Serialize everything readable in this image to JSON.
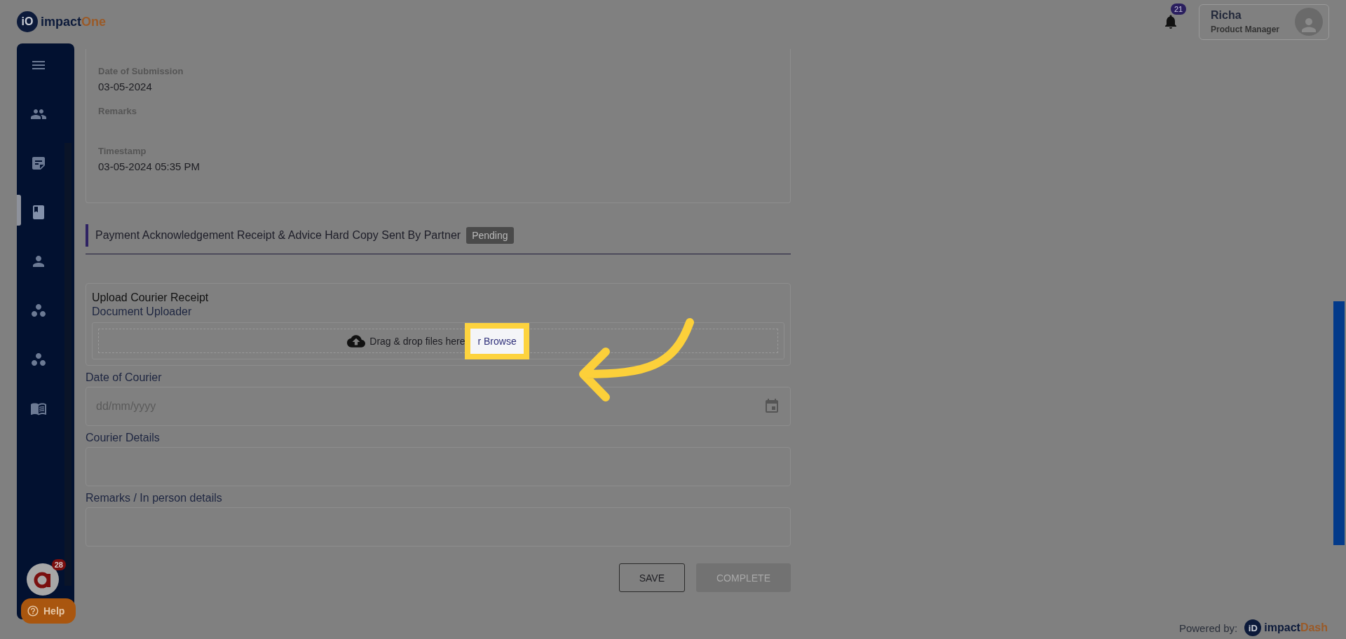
{
  "logo": {
    "mark": "iO",
    "name": "impact",
    "accent": "One"
  },
  "header": {
    "notifications": "21",
    "user": {
      "name": "Richa",
      "role": "Product Manager"
    }
  },
  "sidebar": {
    "items": [
      {
        "kind": "menu",
        "selected": false
      },
      {
        "kind": "people",
        "selected": false
      },
      {
        "kind": "note",
        "selected": false
      },
      {
        "kind": "book",
        "selected": true
      },
      {
        "kind": "person",
        "selected": false
      },
      {
        "kind": "dots",
        "selected": false
      },
      {
        "kind": "dots",
        "selected": false
      },
      {
        "kind": "manual",
        "selected": false
      }
    ],
    "chat_badge": "28",
    "help": "Help"
  },
  "details": [
    {
      "label": "Date of Submission",
      "value": "03-05-2024"
    },
    {
      "label": "Remarks"
    },
    {
      "label": "Timestamp",
      "value": "03-05-2024 05:35 PM"
    }
  ],
  "section": {
    "title": "Payment Acknowledgement Receipt & Advice Hard Copy Sent By Partner",
    "status": "Pending"
  },
  "upload": {
    "title": "Upload Courier Receipt",
    "subtitle": "Document Uploader",
    "drop_text": "Drag & drop files here",
    "browse": "r Browse"
  },
  "fields": [
    {
      "kind": "date",
      "label": "Date of Courier",
      "placeholder": "dd/mm/yyyy"
    },
    {
      "kind": "text",
      "label": "Courier Details"
    },
    {
      "kind": "text",
      "label": "Remarks / In person details"
    }
  ],
  "buttons": [
    {
      "label": "SAVE",
      "disabled": false
    },
    {
      "label": "COMPLETE",
      "disabled": true
    }
  ],
  "footer": {
    "powered": "Powered by:",
    "mark": "iD",
    "name": "impact",
    "accent": "Dash"
  }
}
